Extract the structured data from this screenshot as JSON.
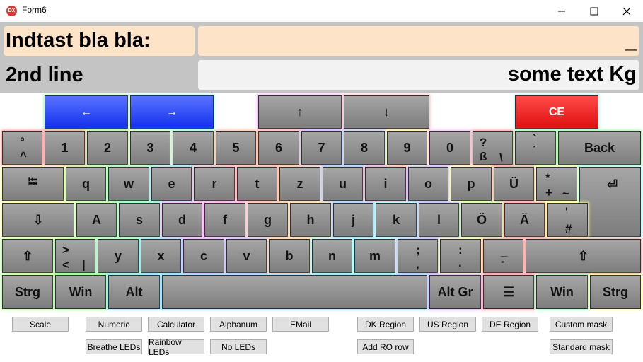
{
  "window": {
    "title": "Form6",
    "icon_text": "DX",
    "icon_name": "devexpress-app-icon",
    "controls": [
      "minimize-icon",
      "maximize-icon",
      "close-icon"
    ]
  },
  "panel": {
    "line1_label": "Indtast bla bla:",
    "line1_value": "",
    "line1_cursor": "_",
    "line2_label": "2nd line",
    "line2_value": "some text Kg"
  },
  "nav_keys": {
    "left": "←",
    "right": "→",
    "up": "↑",
    "down": "↓",
    "ce": "CE"
  },
  "keyboard": {
    "row1": [
      {
        "top": "°",
        "bottom": "^"
      },
      {
        "label": "1"
      },
      {
        "label": "2"
      },
      {
        "label": "3"
      },
      {
        "label": "4"
      },
      {
        "label": "5"
      },
      {
        "label": "6"
      },
      {
        "label": "7"
      },
      {
        "label": "8"
      },
      {
        "label": "9"
      },
      {
        "label": "0"
      },
      {
        "top": "?",
        "bottom": "ß",
        "alt": "\\"
      },
      {
        "top": "`",
        "bottom": "´"
      },
      {
        "label": "Back"
      }
    ],
    "row2": [
      {
        "label": "⭾"
      },
      {
        "label": "q"
      },
      {
        "label": "w"
      },
      {
        "label": "e"
      },
      {
        "label": "r"
      },
      {
        "label": "t"
      },
      {
        "label": "z"
      },
      {
        "label": "u"
      },
      {
        "label": "i"
      },
      {
        "label": "o"
      },
      {
        "label": "p"
      },
      {
        "label": "Ü"
      },
      {
        "top": "*",
        "bottom": "+",
        "alt": "~"
      },
      {
        "label": "⏎"
      }
    ],
    "row3": [
      {
        "label": "⇩"
      },
      {
        "label": "A"
      },
      {
        "label": "s"
      },
      {
        "label": "d"
      },
      {
        "label": "f"
      },
      {
        "label": "g"
      },
      {
        "label": "h"
      },
      {
        "label": "j"
      },
      {
        "label": "k"
      },
      {
        "label": "l"
      },
      {
        "label": "Ö"
      },
      {
        "label": "Ä"
      },
      {
        "top": "'",
        "bottom": "#"
      }
    ],
    "row4": [
      {
        "label": "⇧"
      },
      {
        "top": ">",
        "bottom": "<",
        "alt": "|"
      },
      {
        "label": "y"
      },
      {
        "label": "x"
      },
      {
        "label": "c"
      },
      {
        "label": "v"
      },
      {
        "label": "b"
      },
      {
        "label": "n"
      },
      {
        "label": "m"
      },
      {
        "top": ";",
        "bottom": ","
      },
      {
        "top": ":",
        "bottom": "."
      },
      {
        "top": "_",
        "bottom": "-"
      },
      {
        "label": "⇧"
      }
    ],
    "row5": [
      {
        "label": "Strg"
      },
      {
        "label": "Win"
      },
      {
        "label": "Alt"
      },
      {
        "label": ""
      },
      {
        "label": "Alt Gr"
      },
      {
        "label": "☰"
      },
      {
        "label": "Win"
      },
      {
        "label": "Strg"
      }
    ]
  },
  "buttons": {
    "row1": [
      "Scale",
      "Numeric",
      "Calculator",
      "Alphanum",
      "EMail",
      "DK Region",
      "US Region",
      "DE Region",
      "Custom mask"
    ],
    "row2": [
      "Breathe LEDs",
      "Rainbow LEDs",
      "No LEDs",
      "Add RO row",
      "Standard mask"
    ]
  },
  "colors": {
    "panel_bg": "#c4c4c4",
    "label_bg": "#fde3c8",
    "input_bg": "#fde3c8",
    "line2_input_bg": "#f2f2f2",
    "key_gray": "#8f8f8f",
    "key_blue": "#1f3cf2",
    "key_red": "#f01c1c"
  }
}
